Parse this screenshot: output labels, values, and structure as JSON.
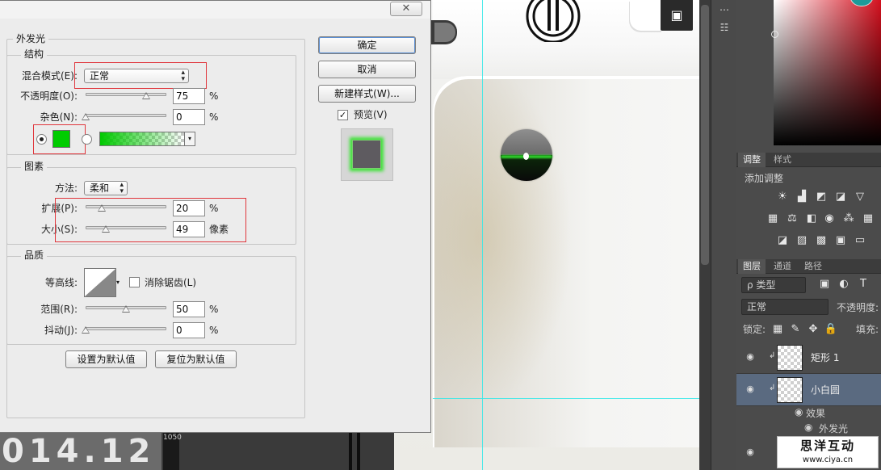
{
  "canvas": {
    "date_text": "014.12",
    "ruler_text": "1050",
    "corner_icon": "cube-icon",
    "logo_icon": "circle-logo-icon"
  },
  "dialog": {
    "close_label": "✕",
    "section_outer_glow": "外发光",
    "structure": {
      "title": "结构",
      "blend_mode_label": "混合模式(E):",
      "blend_mode_value": "正常",
      "opacity_label": "不透明度(O):",
      "opacity_value": "75",
      "opacity_unit": "%",
      "noise_label": "杂色(N):",
      "noise_value": "0",
      "noise_unit": "%",
      "glow_color": "#00cc00"
    },
    "elements": {
      "title": "图素",
      "method_label": "方法:",
      "method_value": "柔和",
      "spread_label": "扩展(P):",
      "spread_value": "20",
      "spread_unit": "%",
      "size_label": "大小(S):",
      "size_value": "49",
      "size_unit": "像素"
    },
    "quality": {
      "title": "品质",
      "contour_label": "等高线:",
      "antialias_label": "消除锯齿(L)",
      "range_label": "范围(R):",
      "range_value": "50",
      "range_unit": "%",
      "jitter_label": "抖动(J):",
      "jitter_value": "0",
      "jitter_unit": "%"
    },
    "set_default": "设置为默认值",
    "reset_default": "复位为默认值",
    "ok": "确定",
    "cancel": "取消",
    "new_style": "新建样式(W)...",
    "preview_label": "预览(V)",
    "preview_checked": "✓",
    "slider_levels": {
      "opacity": 0.75,
      "noise": 0.0,
      "spread": 0.2,
      "size": 0.25,
      "range": 0.5,
      "jitter": 0.0
    }
  },
  "panels": {
    "adjust_tab": "调整",
    "style_tab": "样式",
    "add_adjust": "添加调整",
    "layers_tab": "图层",
    "channels_tab": "通道",
    "paths_tab": "路径",
    "kind_filter": "ρ 类型",
    "blend_mode": "正常",
    "opacity_label": "不透明度:",
    "lock_label": "锁定:",
    "fill_label": "填充:",
    "layers": [
      {
        "name": "矩形 1"
      },
      {
        "name": "小白圆"
      }
    ],
    "effects_label": "效果",
    "outer_glow_label": "外发光"
  },
  "watermark": {
    "main": "思洋互动",
    "sub": "www.ciya.cn"
  }
}
